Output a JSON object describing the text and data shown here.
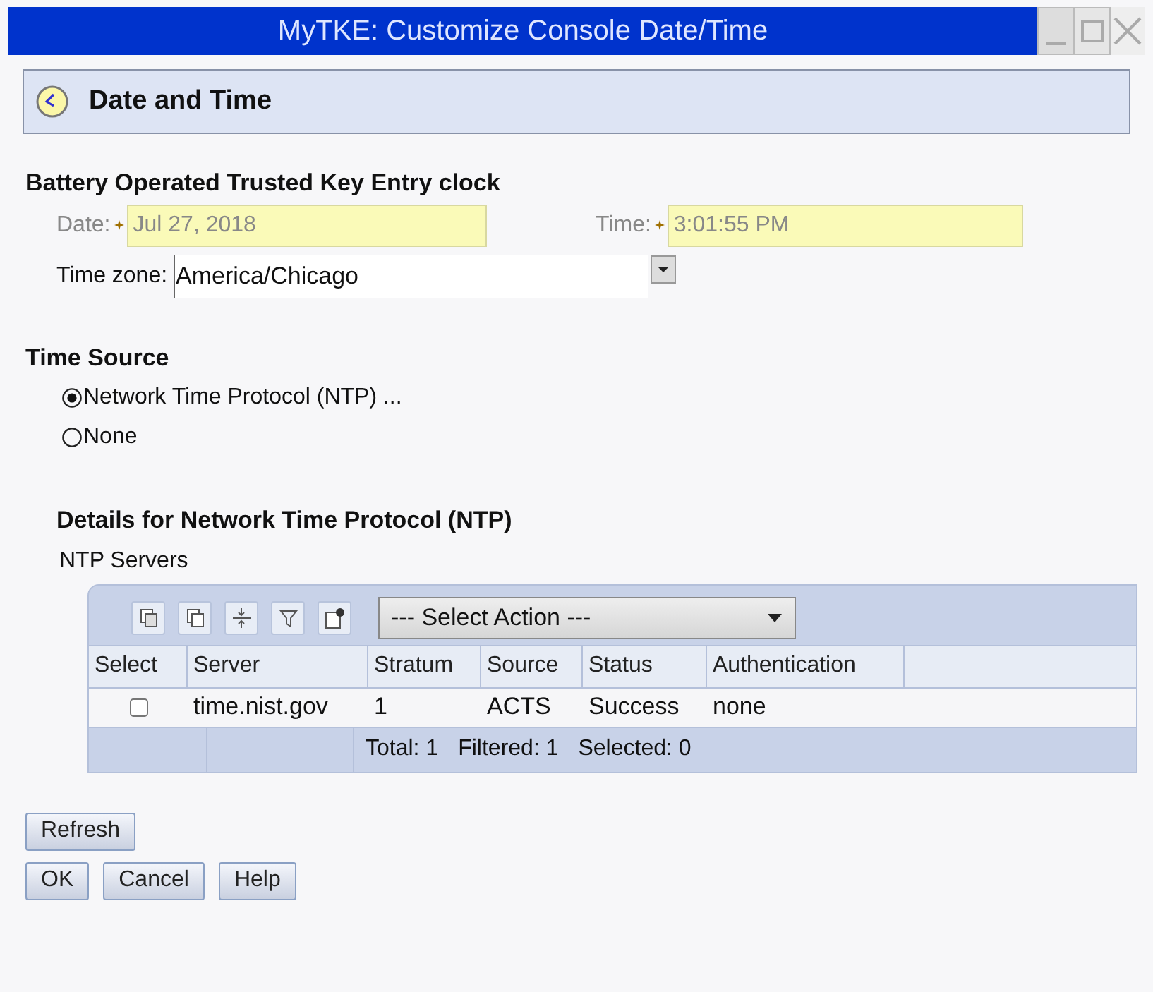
{
  "window": {
    "title": "MyTKE: Customize Console Date/Time"
  },
  "header": {
    "title": "Date and Time"
  },
  "clock": {
    "heading": "Battery Operated Trusted Key Entry clock",
    "date": {
      "label": "Date:",
      "value": "Jul 27, 2018",
      "required": true,
      "disabled": true
    },
    "time": {
      "label": "Time:",
      "value": "3:01:55 PM",
      "required": true,
      "disabled": true
    },
    "timezone": {
      "label": "Time zone:",
      "value": "America/Chicago"
    }
  },
  "time_source": {
    "heading": "Time Source",
    "options": [
      {
        "label": "Network Time Protocol (NTP) ...",
        "selected": true
      },
      {
        "label": "None",
        "selected": false
      }
    ]
  },
  "details": {
    "heading": "Details for Network Time Protocol (NTP)",
    "subheading": "NTP Servers",
    "action_select": {
      "value": "--- Select Action ---"
    },
    "select_header": "Select",
    "columns": [
      "Server",
      "Stratum",
      "Source",
      "Status",
      "Authentication"
    ],
    "rows": [
      {
        "checked": false,
        "cells": [
          "time.nist.gov",
          "1",
          "ACTS",
          "Success",
          "none"
        ]
      }
    ],
    "footer": [
      "Total: 1",
      "Filtered: 1",
      "Selected: 0"
    ]
  },
  "buttons": {
    "refresh": "Refresh",
    "actions": [
      "OK",
      "Cancel",
      "Help"
    ]
  }
}
